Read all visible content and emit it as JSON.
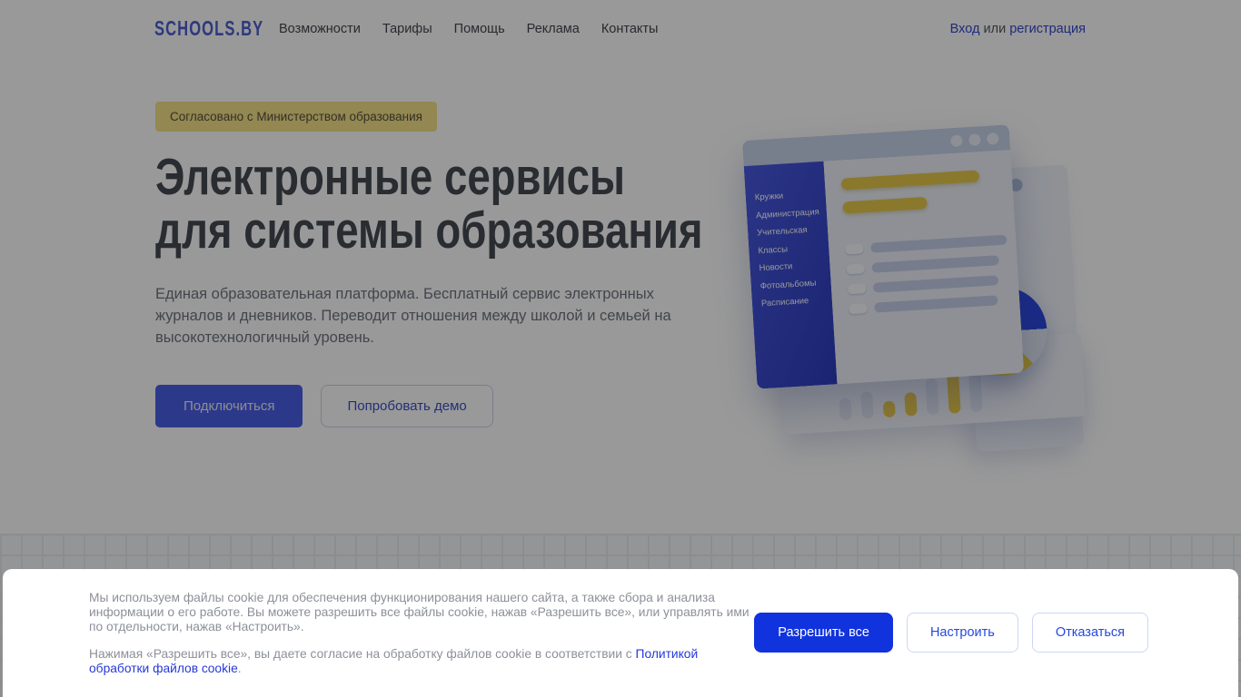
{
  "brand": {
    "logo": "SCHOOLS.BY"
  },
  "header": {
    "nav": [
      "Возможности",
      "Тарифы",
      "Помощь",
      "Реклама",
      "Контакты"
    ],
    "auth": {
      "login": "Вход",
      "separator": " или ",
      "register": "регистрация"
    }
  },
  "hero": {
    "badge": "Согласовано с Министерством образования",
    "heading_line1": "Электронные сервисы",
    "heading_line2": "для системы образования",
    "description": "Единая образовательная платформа. Бесплатный сервис электронных журналов и дневников. Переводит отношения между школой и семьей на высокотехнологичный уровень.",
    "primary_button": "Подключиться",
    "secondary_button": "Попробовать демо"
  },
  "illustration": {
    "menu_items": [
      "Кружки",
      "Администрация",
      "Учительская",
      "Классы",
      "Новости",
      "Фотоальбомы",
      "Расписание"
    ]
  },
  "cookie_banner": {
    "paragraph1": "Мы используем файлы cookie для обеспечения функционирования нашего сайта, а также сбора и анализа информации о его работе. Вы можете разрешить все файлы cookie, нажав «Разрешить все», или управлять ими по отдельности, нажав «Настроить».",
    "paragraph2_prefix": "Нажимая «Разрешить все», вы даете согласие на обработку файлов cookie в соответствии с ",
    "paragraph2_link": "Политикой обработки файлов cookie",
    "paragraph2_suffix": ".",
    "buttons": {
      "allow": "Разрешить все",
      "configure": "Настроить",
      "decline": "Отказаться"
    }
  },
  "colors": {
    "brand_blue": "#1033dd",
    "hero_button_blue": "#4a5fe8",
    "badge_yellow": "#f6e189",
    "chart_yellow": "#e7c84b",
    "pie_blue": "#2b46e0",
    "link_blue": "#2538da"
  }
}
